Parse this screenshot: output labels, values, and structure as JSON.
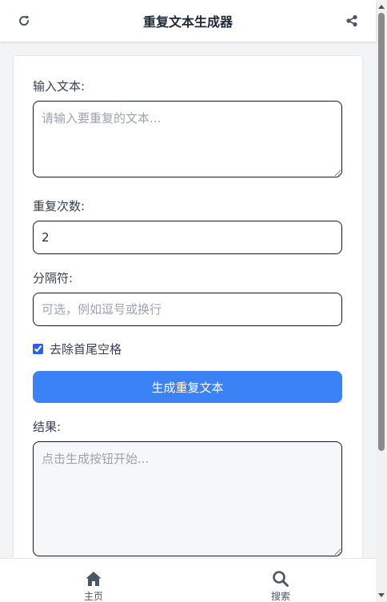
{
  "header": {
    "title": "重复文本生成器",
    "refresh_icon": "refresh-icon",
    "share_icon": "share-icon"
  },
  "form": {
    "input_label": "输入文本:",
    "input_placeholder": "请输入要重复的文本...",
    "input_value": "",
    "count_label": "重复次数:",
    "count_value": "2",
    "separator_label": "分隔符:",
    "separator_placeholder": "可选，例如逗号或换行",
    "separator_value": "",
    "trim_label": "去除首尾空格",
    "trim_checked": true,
    "generate_label": "生成重复文本",
    "result_label": "结果:",
    "result_placeholder": "点击生成按钮开始...",
    "result_value": ""
  },
  "nav": {
    "items": [
      {
        "label": "主页",
        "icon": "home-icon"
      },
      {
        "label": "搜索",
        "icon": "search-icon"
      }
    ]
  },
  "colors": {
    "accent": "#3b82f6",
    "icon": "#4b5563",
    "background": "#f3f4f6"
  }
}
